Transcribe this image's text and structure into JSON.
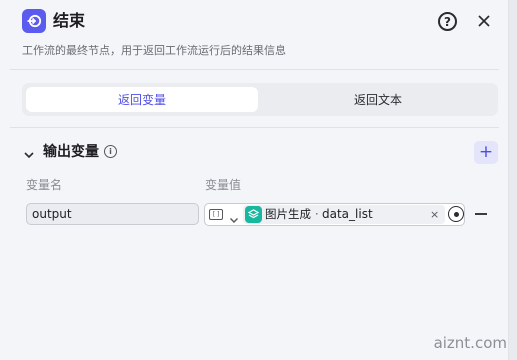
{
  "header": {
    "title": "结束",
    "description": "工作流的最终节点，用于返回工作流运行后的结果信息"
  },
  "tabs": [
    {
      "label": "返回变量",
      "active": true
    },
    {
      "label": "返回文本",
      "active": false
    }
  ],
  "output_section": {
    "title": "输出变量",
    "columns": {
      "name": "变量名",
      "value": "变量值"
    },
    "rows": [
      {
        "name": "output",
        "value_type_icon": "array-icon",
        "reference": {
          "node": "图片生成",
          "separator": "·",
          "variable": "data_list",
          "clear": "×"
        }
      }
    ]
  },
  "watermark": "aiznt.com",
  "colors": {
    "accent": "#4e4ee6",
    "node_icon": "#5b5bf0",
    "ref_icon": "#17b7a0"
  }
}
